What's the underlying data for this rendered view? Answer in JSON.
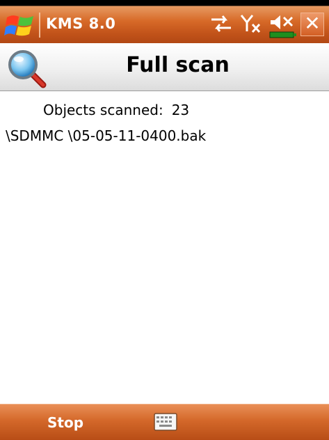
{
  "statusbar": {
    "app_title": "KMS 8.0",
    "icons": [
      "windows-start-icon",
      "sync-arrows-icon",
      "signal-off-icon",
      "speaker-muted-icon",
      "battery-icon"
    ],
    "close_label": "✕"
  },
  "header": {
    "icon": "magnifier-icon",
    "title": "Full scan"
  },
  "scan": {
    "objects_label": "Objects scanned:",
    "objects_count": "23",
    "current_file": "\\SDMMC \\05-05-11-0400.bak"
  },
  "bottombar": {
    "left_softkey": "Stop",
    "center_icon": "keyboard-icon"
  },
  "colors": {
    "bar_orange": "#d4682a",
    "header_gray": "#e8e8e8"
  }
}
